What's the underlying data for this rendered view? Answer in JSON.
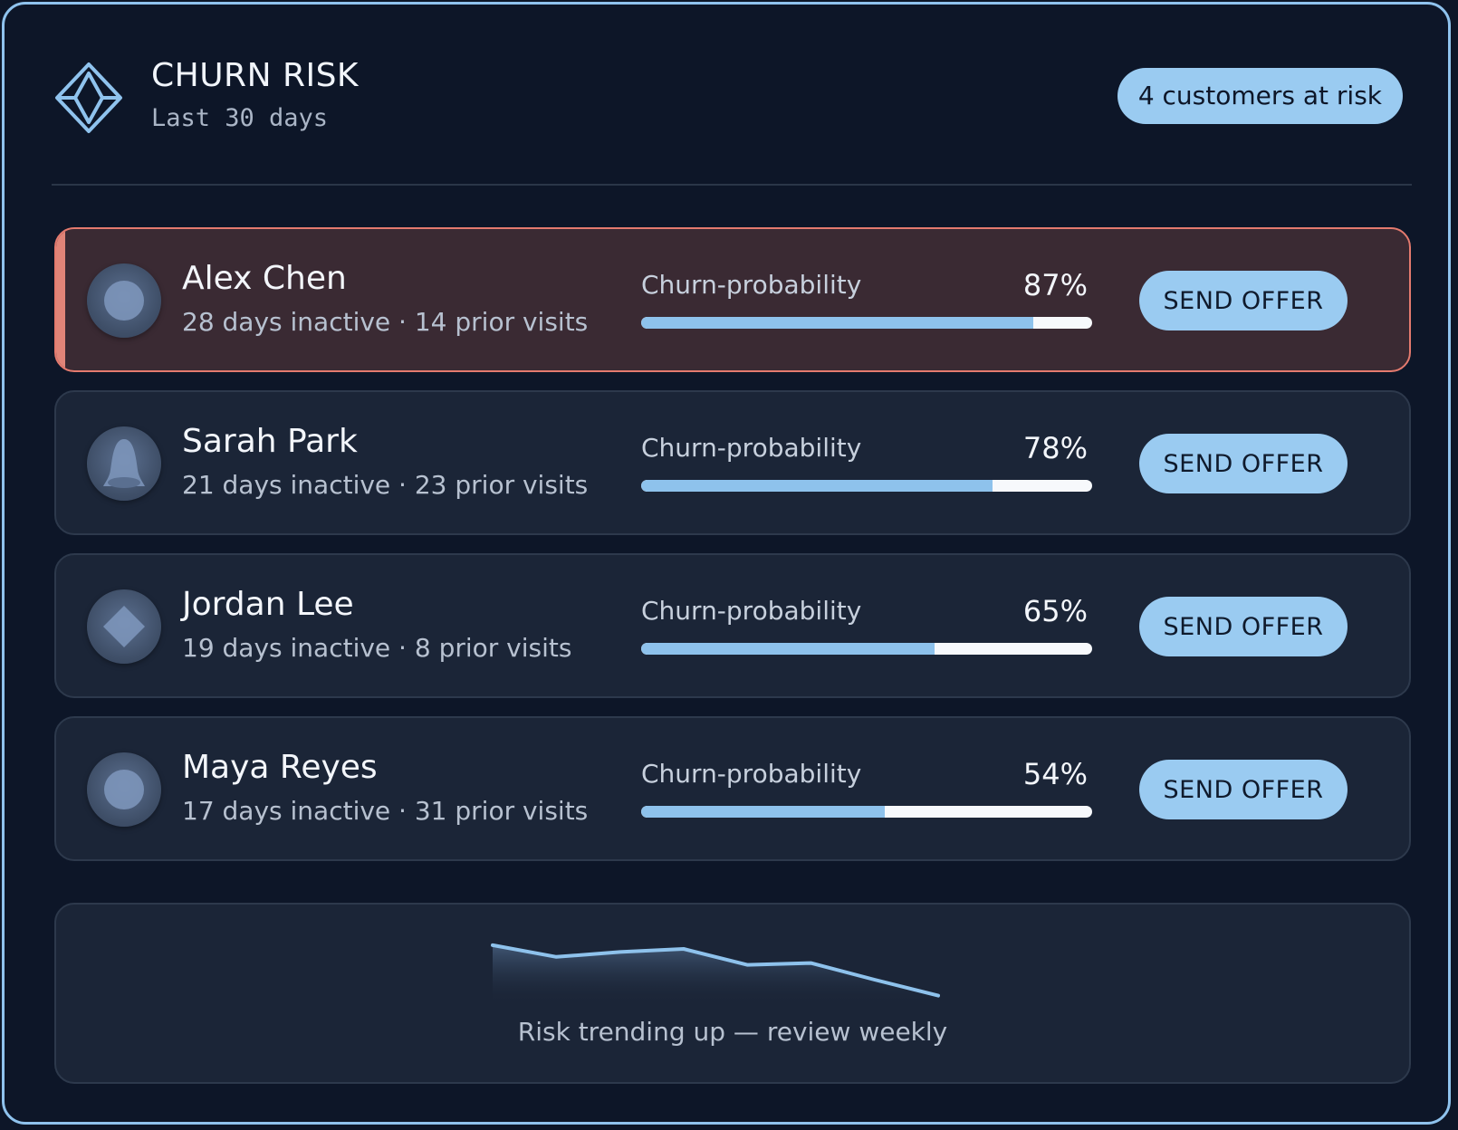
{
  "header": {
    "title": "CHURN RISK",
    "subtitle": "Last 30 days",
    "badge": "4 customers at risk"
  },
  "colors": {
    "accent": "#9acbf1",
    "highlight_border": "#e47a6e",
    "background": "#0d1628",
    "card": "#1b2537"
  },
  "customers": [
    {
      "name": "Alex Chen",
      "meta": "28 days inactive · 14 prior visits",
      "prob_label": "Churn-probability",
      "prob_text": "87%",
      "prob": 87,
      "action": "SEND OFFER",
      "avatar_icon": "circle-avatar-icon",
      "highlighted": true
    },
    {
      "name": "Sarah Park",
      "meta": "21 days inactive · 23 prior visits",
      "prob_label": "Churn-probability",
      "prob_text": "78%",
      "prob": 78,
      "action": "SEND OFFER",
      "avatar_icon": "bell-avatar-icon",
      "highlighted": false
    },
    {
      "name": "Jordan Lee",
      "meta": "19 days inactive · 8 prior visits",
      "prob_label": "Churn-probability",
      "prob_text": "65%",
      "prob": 65,
      "action": "SEND OFFER",
      "avatar_icon": "diamond-avatar-icon",
      "highlighted": false
    },
    {
      "name": "Maya Reyes",
      "meta": "17 days inactive · 31 prior visits",
      "prob_label": "Churn-probability",
      "prob_text": "54%",
      "prob": 54,
      "action": "SEND OFFER",
      "avatar_icon": "circle-avatar-icon",
      "highlighted": false
    }
  ],
  "trend": {
    "caption": "Risk trending up — review weekly",
    "values": [
      0.84,
      0.65,
      0.73,
      0.78,
      0.52,
      0.55,
      0.28,
      0.02
    ]
  }
}
